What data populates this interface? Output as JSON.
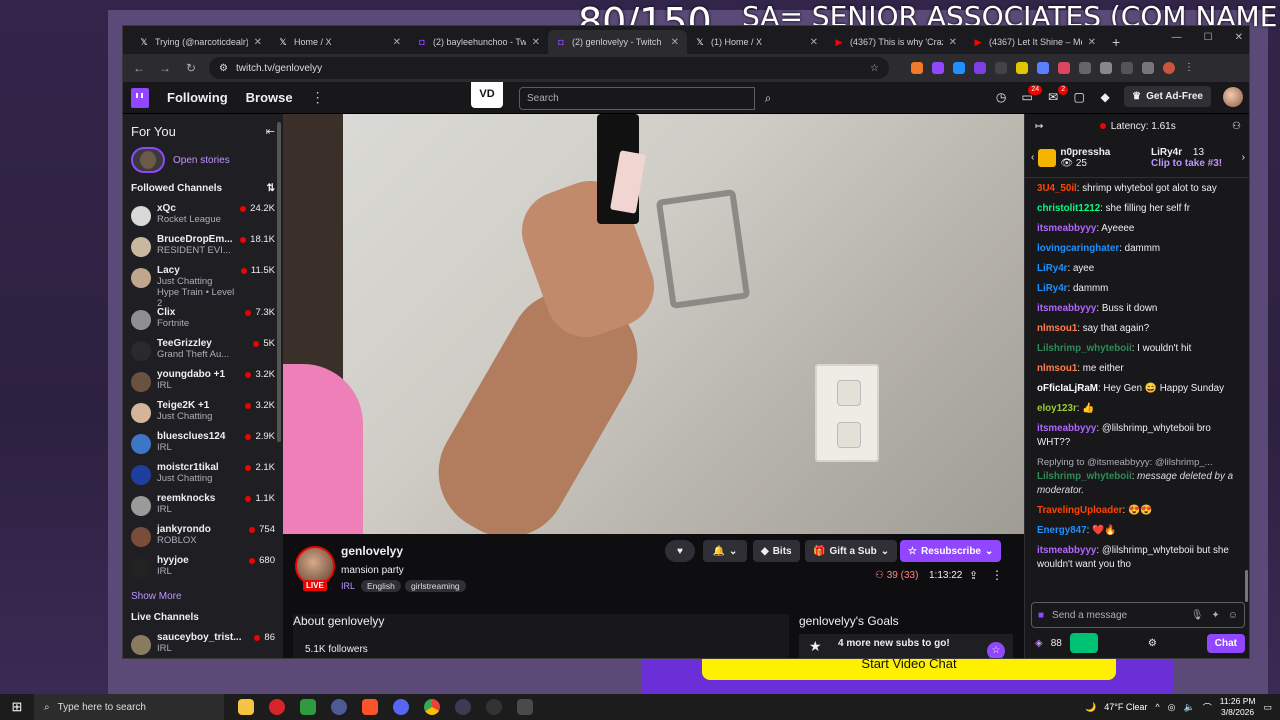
{
  "overlay": {
    "counter": "80/150",
    "title": "SA= SENIOR ASSOCIATES (COM NAME)",
    "start_video_chat": "Start Video Chat"
  },
  "browser": {
    "tabs": [
      {
        "label": "Trying (@narcoticdealr) | T",
        "icon": "x-icon",
        "active": false
      },
      {
        "label": "Home / X",
        "icon": "x-icon",
        "active": false
      },
      {
        "label": "(2) bayleehunchoo - Twitc",
        "icon": "twitch-icon",
        "active": false
      },
      {
        "label": "(2) genlovelyy - Twitch",
        "icon": "twitch-icon",
        "active": true
      },
      {
        "label": "(1) Home / X",
        "icon": "x-icon",
        "active": false
      },
      {
        "label": "(4367) This is why 'Crazy",
        "icon": "youtube-icon",
        "active": false
      },
      {
        "label": "(4367) Let It Shine – Me a",
        "icon": "youtube-icon",
        "active": false
      }
    ],
    "url": "twitch.tv/genlovelyy"
  },
  "twitch_nav": {
    "following": "Following",
    "browse": "Browse",
    "vd_label": "VD",
    "search_placeholder": "Search",
    "notifications_count": "24",
    "inbox_count": "2",
    "get_ad_free": "Get Ad-Free"
  },
  "sidebar": {
    "for_you": "For You",
    "open_stories": "Open stories",
    "followed_channels": "Followed Channels",
    "channels": [
      {
        "name": "xQc",
        "game": "Rocket League",
        "viewers": "24.2K",
        "color": "#d9d9d9"
      },
      {
        "name": "BruceDropEm...",
        "game": "RESIDENT EVI...",
        "viewers": "18.1K",
        "color": "#c8b8a0"
      },
      {
        "name": "Lacy",
        "game": "Just Chatting",
        "viewers": "11.5K",
        "color": "#bfa68d",
        "extra": "Hype Train • Level 2"
      },
      {
        "name": "Clix",
        "game": "Fortnite",
        "viewers": "7.3K",
        "color": "#8f8f8f"
      },
      {
        "name": "TeeGrizzley",
        "game": "Grand Theft Au...",
        "viewers": "5K",
        "color": "#2a2a2a"
      },
      {
        "name": "youngdabo +1",
        "game": "IRL",
        "viewers": "3.2K",
        "color": "#6b5140"
      },
      {
        "name": "Teige2K +1",
        "game": "Just Chatting",
        "viewers": "3.2K",
        "color": "#d4b59a"
      },
      {
        "name": "bluesclues124",
        "game": "IRL",
        "viewers": "2.9K",
        "color": "#3d76c7"
      },
      {
        "name": "moistcr1tikal",
        "game": "Just Chatting",
        "viewers": "2.1K",
        "color": "#1f3fa0"
      },
      {
        "name": "reemknocks",
        "game": "IRL",
        "viewers": "1.1K",
        "color": "#9a9a9a"
      },
      {
        "name": "jankyrondo",
        "game": "ROBLOX",
        "viewers": "754",
        "color": "#7a4d3a"
      },
      {
        "name": "hyyjoe",
        "game": "IRL",
        "viewers": "680",
        "color": "#222222"
      }
    ],
    "show_more": "Show More",
    "live_channels": "Live Channels",
    "live": [
      {
        "name": "sauceyboy_trist...",
        "game": "IRL",
        "viewers": "86",
        "color": "#8a7a60"
      }
    ]
  },
  "stream": {
    "streamer": "genlovelyy",
    "live_badge": "LIVE",
    "title": "mansion party",
    "category": "IRL",
    "tags": [
      "English",
      "girlstreaming"
    ],
    "bits": "Bits",
    "gift_sub": "Gift a Sub",
    "resubscribe": "Resubscribe",
    "viewers": "39 (33)",
    "uptime": "1:13:22",
    "about": "About genlovelyy",
    "followers": "5.1K followers",
    "goals_title": "genlovelyy's Goals",
    "goal_text": "4 more new subs to go!"
  },
  "chat": {
    "latency": "Latency: 1.61s",
    "hype_user": "n0pressha",
    "hype_count": "25",
    "clip_user": "LiRy4r",
    "clip_count": "13",
    "clip_text": "Clip to take #3!",
    "messages": [
      {
        "user": "3U4_50il",
        "text": "shrimp whytebol got alot to say",
        "color": "#ff4500"
      },
      {
        "user": "christolit1212",
        "text": "she filling her self fr",
        "color": "#00ff7f"
      },
      {
        "user": "itsmeabbyyy",
        "text": "Ayeeee",
        "color": "#b266ff"
      },
      {
        "user": "lovingcaringhater",
        "text": "dammm",
        "color": "#1e90ff"
      },
      {
        "user": "LiRy4r",
        "text": "ayee",
        "color": "#1e90ff"
      },
      {
        "user": "LiRy4r",
        "text": "dammm",
        "color": "#1e90ff"
      },
      {
        "user": "itsmeabbyyy",
        "text": "Buss it down",
        "color": "#b266ff"
      },
      {
        "user": "nlmsou1",
        "text": "say that again?",
        "color": "#ff7f50"
      },
      {
        "user": "Lilshrimp_whyteboii",
        "text": "I wouldn't hit",
        "color": "#2e8b57"
      },
      {
        "user": "nlmsou1",
        "text": "me either",
        "color": "#ff7f50"
      },
      {
        "user": "oFficIaLjRaM",
        "text": "Hey Gen 😄 Happy Sunday",
        "color": "#ffffff"
      },
      {
        "user": "eloy123r",
        "text": "👍",
        "color": "#9acd32"
      },
      {
        "user": "itsmeabbyyy",
        "text": "@lilshrimp_whyteboii bro WHT??",
        "color": "#b266ff"
      }
    ],
    "reply_label": "Replying to @itsmeabbyyy: @lilshrimp_...",
    "reply_user": "Lilshrimp_whyteboii",
    "reply_text": "message deleted by a moderator.",
    "messages2": [
      {
        "user": "TravelingUploader",
        "text": "😍😍",
        "color": "#ff4500"
      },
      {
        "user": "Energy847",
        "text": "❤️🔥",
        "color": "#1e90ff"
      },
      {
        "user": "itsmeabbyyy",
        "text": "@lilshrimp_whyteboii but she wouldn't want you tho",
        "color": "#b266ff"
      }
    ],
    "input_placeholder": "Send a message",
    "points": "88",
    "chat_button": "Chat"
  },
  "taskbar": {
    "search_placeholder": "Type here to search",
    "weather": "47°F  Clear",
    "time": "11:26 PM",
    "date": "3/8/2026"
  }
}
